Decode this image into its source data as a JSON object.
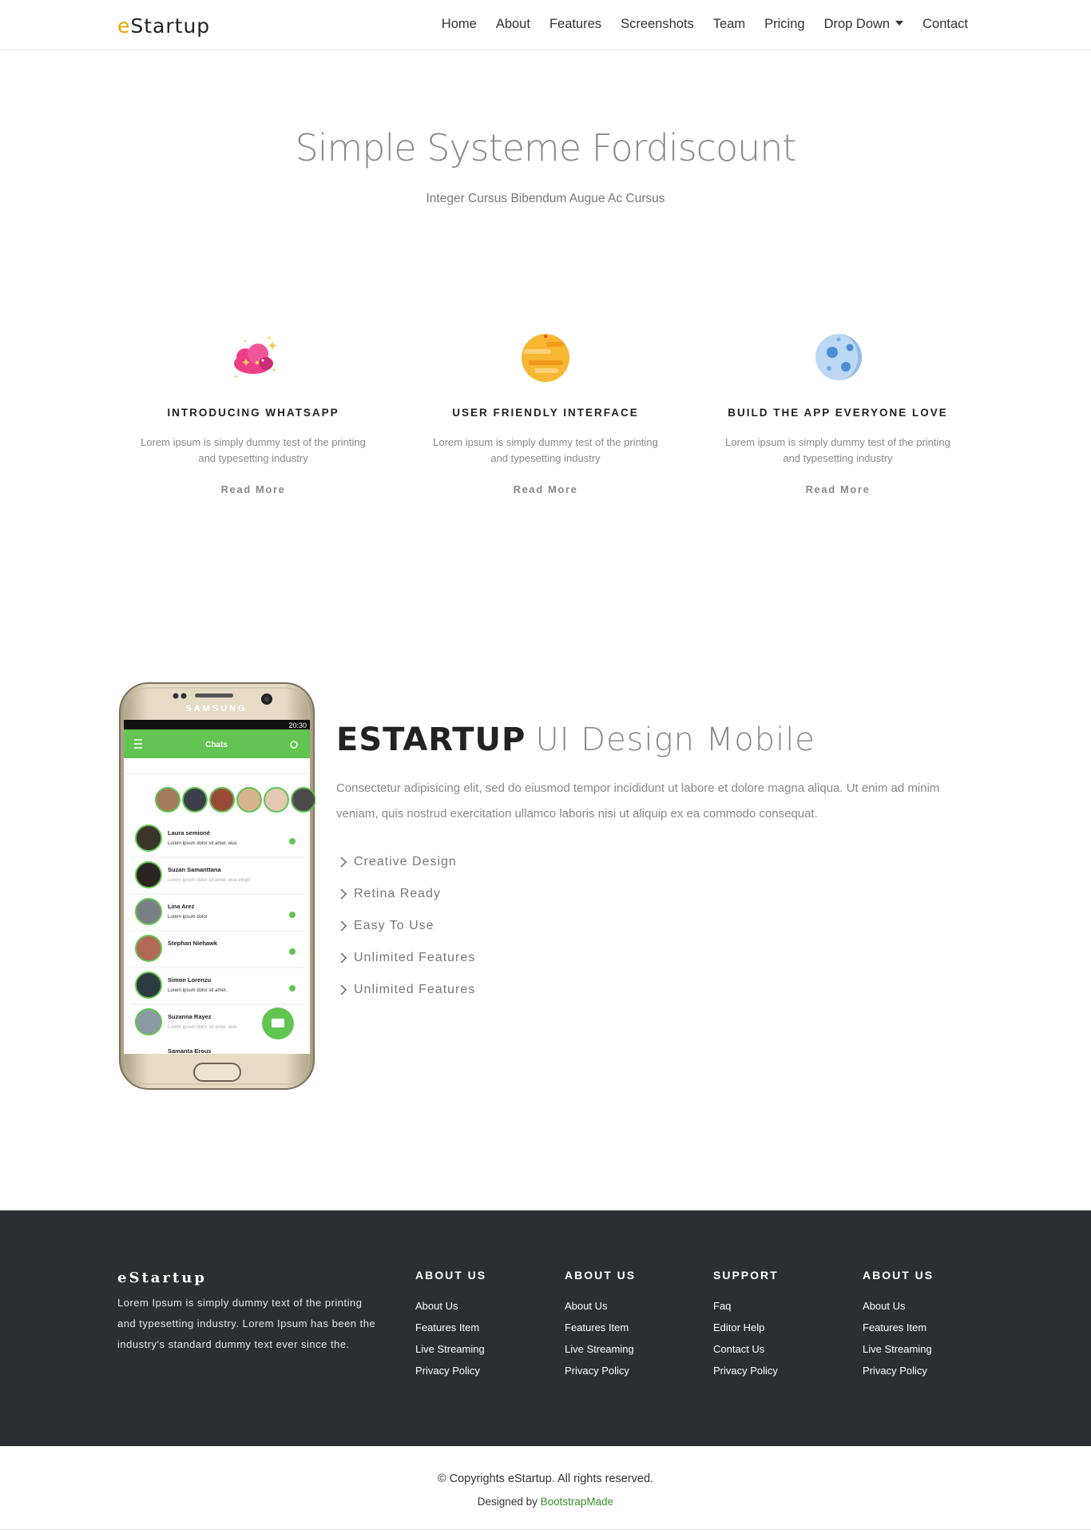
{
  "header": {
    "logo_first": "e",
    "logo_rest": "Startup",
    "nav": [
      "Home",
      "About",
      "Features",
      "Screenshots",
      "Team",
      "Pricing",
      "Drop Down",
      "Contact"
    ]
  },
  "hero": {
    "title": "Simple Systeme Fordiscount",
    "subtitle": "Integer Cursus Bibendum Augue Ac Cursus"
  },
  "features": [
    {
      "icon": "cloud-icon",
      "title": "INTRODUCING WHATSAPP",
      "text": "Lorem ipsum is simply dummy test of the printing and typesetting industry",
      "link": "Read More"
    },
    {
      "icon": "planet-icon",
      "title": "USER FRIENDLY INTERFACE",
      "text": "Lorem ipsum is simply dummy test of the printing and typesetting industry",
      "link": "Read More"
    },
    {
      "icon": "moon-icon",
      "title": "BUILD THE APP EVERYONE LOVE",
      "text": "Lorem ipsum is simply dummy test of the printing and typesetting industry",
      "link": "Read More"
    }
  ],
  "about": {
    "title_strong": "ESTARTUP",
    "title_light": "UI Design Mobile",
    "description": "Consectetur adipisicing elit, sed do eiusmod tempor incididunt ut labore et dolore magna aliqua. Ut enim ad minim veniam, quis nostrud exercitation ullamco laboris nisi ut aliquip ex ea commodo consequat.",
    "list": [
      "Creative Design",
      "Retina Ready",
      "Easy To Use",
      "Unlimited Features",
      "Unlimited Features"
    ]
  },
  "phone": {
    "brand": "SAMSUNG",
    "time": "20:30",
    "app_title": "Chats",
    "chats": [
      {
        "name": "Laura semioné",
        "msg": "Lorem ipsum dolor sit amet, eius"
      },
      {
        "name": "Suzan Samanttana",
        "msg": "Lorem ipsum dolor sit amet, eius elogn"
      },
      {
        "name": "Lina Arez",
        "msg": "Lorem ipsum dolor"
      },
      {
        "name": "Stephan Niehawk",
        "msg": ""
      },
      {
        "name": "Simon Lorenzu",
        "msg": "Lorem ipsum dolor sit amet."
      },
      {
        "name": "Suzanna Rayez",
        "msg": "Lorem ipsum dolor sit amet, eius"
      },
      {
        "name": "Samanta Erous",
        "msg": ""
      }
    ]
  },
  "footer": {
    "logo": "eStartup",
    "text": "Lorem Ipsum is simply dummy text of the printing and typesetting industry. Lorem Ipsum has been the industry's standard dummy text ever since the.",
    "columns": [
      {
        "title": "ABOUT US",
        "links": [
          "About Us",
          "Features Item",
          "Live Streaming",
          "Privacy Policy"
        ]
      },
      {
        "title": "ABOUT US",
        "links": [
          "About Us",
          "Features Item",
          "Live Streaming",
          "Privacy Policy"
        ]
      },
      {
        "title": "SUPPORT",
        "links": [
          "Faq",
          "Editor Help",
          "Contact Us",
          "Privacy Policy"
        ]
      },
      {
        "title": "ABOUT US",
        "links": [
          "About Us",
          "Features Item",
          "Live Streaming",
          "Privacy Policy"
        ]
      }
    ]
  },
  "bottom": {
    "copyright": "© Copyrights eStartup. All rights reserved.",
    "designed_by": "Designed by",
    "designer": "BootstrapMade"
  }
}
